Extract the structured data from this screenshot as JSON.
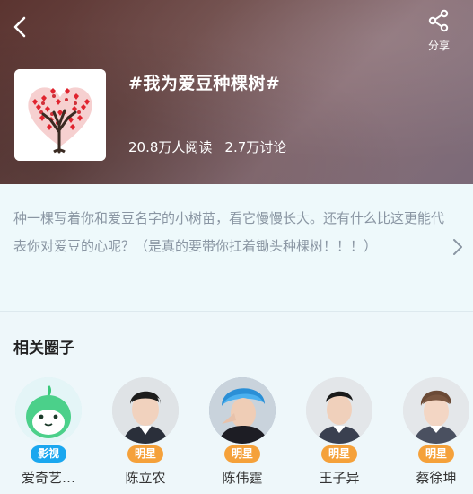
{
  "header": {
    "share_label": "分享",
    "title": "#我为爱豆种棵树#",
    "reads": "20.8万人阅读",
    "discussions": "2.7万讨论"
  },
  "description": {
    "text": "种一棵写着你和爱豆名字的小树苗，看它慢慢长大。还有什么比这更能代表你对爱豆的心呢？（是真的要带你扛着锄头种棵树！！！）"
  },
  "related": {
    "title": "相关圈子",
    "items": [
      {
        "name": "爱奇艺…",
        "badge": "影视",
        "badge_color": "#1aa7ef"
      },
      {
        "name": "陈立农",
        "badge": "明星",
        "badge_color": "#f5a13a"
      },
      {
        "name": "陈伟霆",
        "badge": "明星",
        "badge_color": "#f5a13a"
      },
      {
        "name": "王子异",
        "badge": "明星",
        "badge_color": "#f5a13a"
      },
      {
        "name": "蔡徐坤",
        "badge": "明星",
        "badge_color": "#f5a13a"
      }
    ]
  },
  "icons": {
    "back": "chevron-left-icon",
    "share": "share-icon",
    "expand": "chevron-right-icon"
  }
}
